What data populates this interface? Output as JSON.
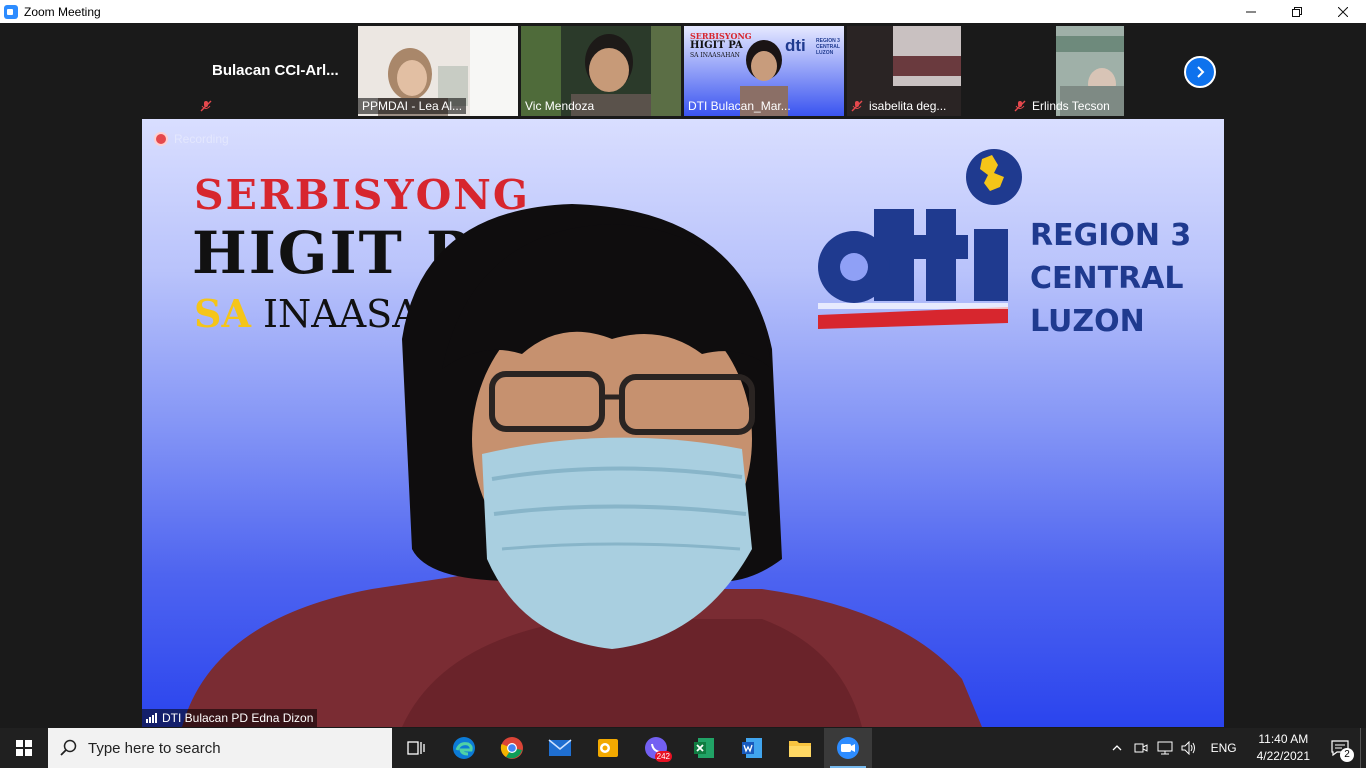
{
  "window": {
    "title": "Zoom Meeting"
  },
  "gallery": {
    "tiles": [
      {
        "name": "Bulacan  CCI-Arl...",
        "muted": true
      },
      {
        "name": "PPMDAI - Lea Al...",
        "muted": false
      },
      {
        "name": "Vic Mendoza",
        "muted": false
      },
      {
        "name": "DTI Bulacan_Mar...",
        "muted": false
      },
      {
        "name": "isabelita deg...",
        "muted": true
      },
      {
        "name": "Erlinds Tecson",
        "muted": true
      }
    ],
    "tile_banner": {
      "line1": "SERBISYONG",
      "line2": "HIGIT PA",
      "line3": "SA INAASAHAN",
      "region": "REGION 3 CENTRAL LUZON"
    }
  },
  "main_video": {
    "recording_label": "Recording",
    "banner": {
      "line1": "SERBISYONG",
      "line2": "HIGIT PA",
      "line3_sa": "SA",
      "line3_rest": "INAASAH"
    },
    "logo_text": "dti",
    "region_lines": [
      "REGION 3",
      "CENTRAL",
      "LUZON"
    ],
    "speaker": "DTI Bulacan PD Edna Dizon"
  },
  "taskbar": {
    "search_placeholder": "Type here to search",
    "icons": [
      "task-view-icon",
      "edge-icon",
      "chrome-icon",
      "mail-icon",
      "outlook-icon",
      "viber-icon",
      "excel-icon",
      "word-icon",
      "file-explorer-icon",
      "zoom-icon"
    ],
    "viber_badge": "242",
    "language": "ENG",
    "time": "11:40 AM",
    "date": "4/22/2021",
    "notifications": "2"
  },
  "colors": {
    "zoom_blue": "#2d8cff",
    "next_btn": "#0e72ed",
    "banner_red": "#d7262e",
    "banner_yellow": "#f5c518",
    "dti_blue": "#1f3a8f"
  }
}
